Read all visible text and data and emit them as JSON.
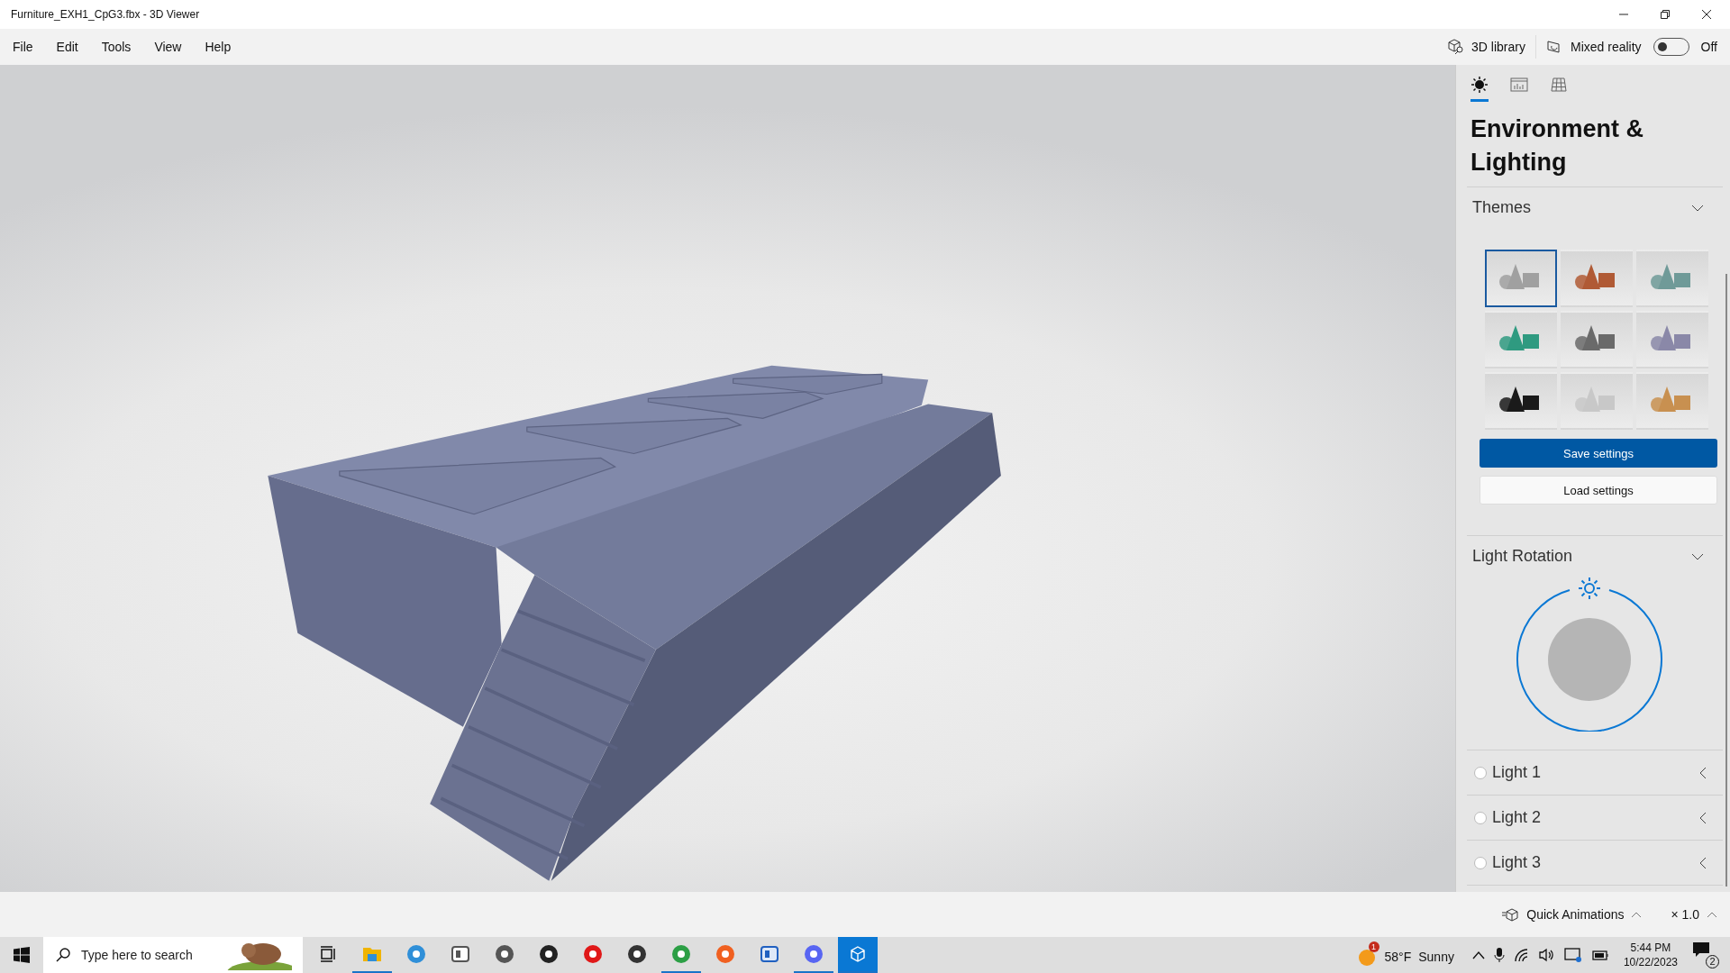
{
  "window": {
    "title": "Furniture_EXH1_CpG3.fbx - 3D Viewer"
  },
  "menu": [
    "File",
    "Edit",
    "Tools",
    "View",
    "Help"
  ],
  "toolbar": {
    "library": "3D library",
    "mixed_reality": "Mixed reality",
    "toggle": {
      "on": false,
      "label": "Off"
    }
  },
  "panel": {
    "tabs": [
      {
        "kind": "sun",
        "selected": true
      },
      {
        "kind": "stats",
        "selected": false
      },
      {
        "kind": "grid",
        "selected": false
      }
    ],
    "title": "Environment & Lighting",
    "themes": {
      "label": "Themes",
      "expanded": true,
      "items": [
        {
          "color": "#a0a0a0",
          "selected": true
        },
        {
          "color": "#b05a35",
          "selected": false
        },
        {
          "color": "#6f9a98",
          "selected": false
        },
        {
          "color": "#2f9a80",
          "selected": false
        },
        {
          "color": "#6a6a6a",
          "selected": false
        },
        {
          "color": "#8a88a8",
          "selected": false
        },
        {
          "color": "#1a1a1a",
          "selected": false
        },
        {
          "color": "#c8c8c8",
          "selected": false
        },
        {
          "color": "#c89050",
          "selected": false
        }
      ]
    },
    "save": "Save settings",
    "load": "Load settings",
    "rotation": {
      "label": "Light Rotation",
      "expanded": true
    },
    "lights": [
      {
        "label": "Light 1",
        "selected": false
      },
      {
        "label": "Light 2",
        "selected": false
      },
      {
        "label": "Light 3",
        "selected": false
      }
    ]
  },
  "bottom_bar": {
    "animations": "Quick Animations",
    "speed": "× 1.0"
  },
  "taskbar": {
    "search": {
      "placeholder": "Type here to search"
    },
    "apps": [
      {
        "kind": "task-view",
        "running": false
      },
      {
        "kind": "folder",
        "running": true
      },
      {
        "kind": "cube",
        "running": false
      },
      {
        "kind": "face",
        "running": false
      },
      {
        "kind": "animal",
        "running": false
      },
      {
        "kind": "dell",
        "running": false
      },
      {
        "kind": "play",
        "running": false
      },
      {
        "kind": "obs",
        "running": false
      },
      {
        "kind": "chrome",
        "running": true
      },
      {
        "kind": "firefox",
        "running": false
      },
      {
        "kind": "window",
        "running": false
      },
      {
        "kind": "chat",
        "running": true
      },
      {
        "kind": "viewer",
        "running": true
      }
    ],
    "weather": {
      "badge": "1",
      "temperature": "58°F",
      "condition": "Sunny"
    },
    "time": "5:44 PM",
    "date": "10/22/2023",
    "notifications": "2"
  }
}
